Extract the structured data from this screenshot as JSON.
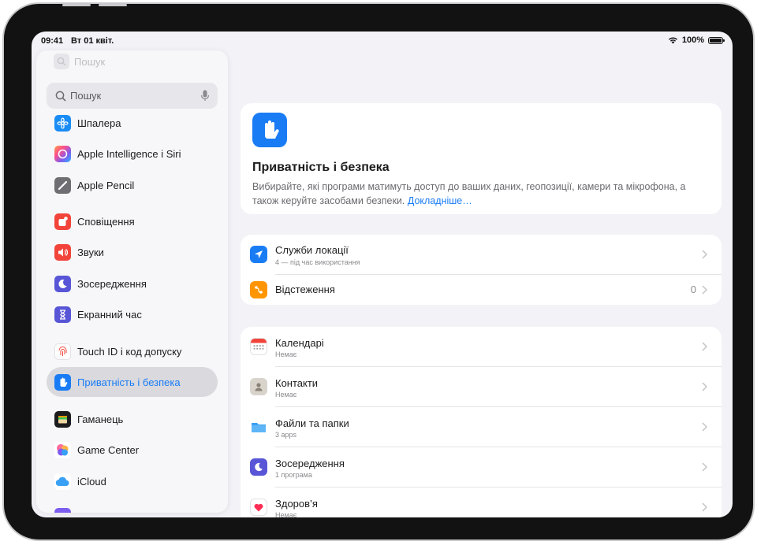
{
  "status_bar": {
    "time": "09:41",
    "date": "Вт 01 квіт.",
    "battery": "100%"
  },
  "sidebar": {
    "ghost_search": "Пошук",
    "search_placeholder": "Пошук",
    "items": [
      {
        "label": "Шпалера",
        "icon": "wallpaper-icon",
        "color": "#1a8cf5"
      },
      {
        "label": "Apple Intelligence і Siri",
        "icon": "apple-intelligence-icon",
        "color": "#7d5cf0"
      },
      {
        "label": "Apple Pencil",
        "icon": "pencil-icon",
        "color": "#6e6e73"
      },
      {
        "label": "Сповіщення",
        "icon": "notifications-icon",
        "color": "#f2443a"
      },
      {
        "label": "Звуки",
        "icon": "sounds-icon",
        "color": "#f2443a"
      },
      {
        "label": "Зосередження",
        "icon": "focus-moon-icon",
        "color": "#5856d6"
      },
      {
        "label": "Екранний час",
        "icon": "hourglass-icon",
        "color": "#5856d6"
      },
      {
        "label": "Touch ID і код допуску",
        "icon": "fingerprint-icon",
        "color": "#f2443a"
      },
      {
        "label": "Приватність і безпека",
        "icon": "privacy-hand-icon",
        "color": "#1a7cf5",
        "selected": true
      },
      {
        "label": "Гаманець",
        "icon": "wallet-icon",
        "color": "#1c1c1e"
      },
      {
        "label": "Game Center",
        "icon": "game-center-icon",
        "color": "#ff6b9a"
      },
      {
        "label": "iCloud",
        "icon": "icloud-icon",
        "color": "#3aa0f5"
      }
    ]
  },
  "hero": {
    "icon": "privacy-hand-icon",
    "title": "Приватність і безпека",
    "description": "Вибирайте, які програми матимуть доступ до ваших даних, геопозиції, камери та мікрофона, а також керуйте засобами безпеки.",
    "link": "Докладніше…"
  },
  "location_group": [
    {
      "title": "Служби локації",
      "subtitle": "4 — під час використання",
      "icon": "location-arrow-icon",
      "color": "#1a7cf5"
    },
    {
      "title": "Відстеження",
      "value": "0",
      "icon": "tracking-icon",
      "color": "#ff9500"
    }
  ],
  "apps_group": [
    {
      "title": "Календарі",
      "subtitle": "Немає",
      "icon": "calendar-icon"
    },
    {
      "title": "Контакти",
      "subtitle": "Немає",
      "icon": "contacts-icon"
    },
    {
      "title": "Файли та папки",
      "subtitle": "3 apps",
      "icon": "folder-icon"
    },
    {
      "title": "Зосередження",
      "subtitle": "1 програма",
      "icon": "focus-moon-icon"
    },
    {
      "title": "Здоров’я",
      "subtitle": "Немає",
      "icon": "health-heart-icon"
    }
  ],
  "colors": {
    "accent": "#1a7cf5",
    "background": "#f2f2f7",
    "card": "#ffffff"
  }
}
